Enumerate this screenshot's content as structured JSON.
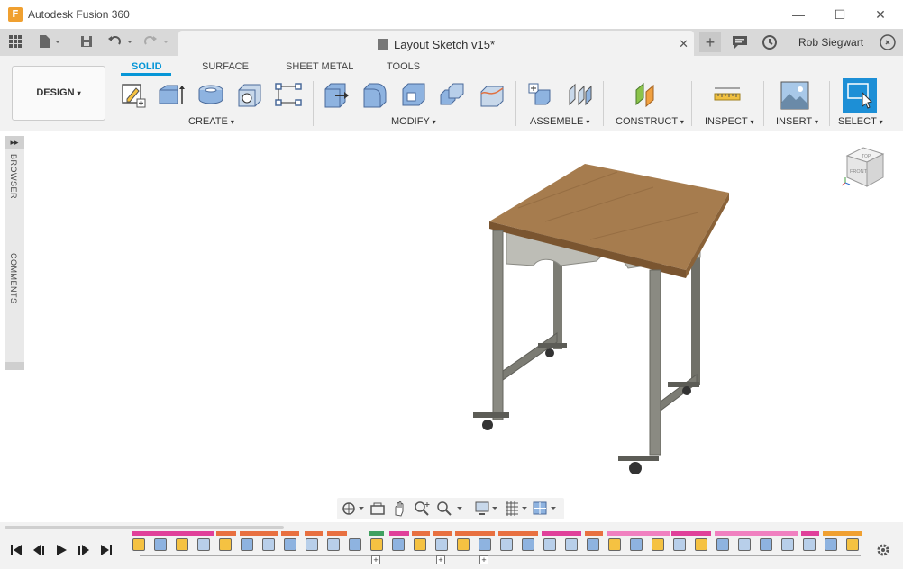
{
  "window": {
    "title": "Autodesk Fusion 360",
    "logo_letter": "F"
  },
  "window_controls": {
    "minimize": "—",
    "maximize": "☐",
    "close": "✕"
  },
  "quick_access": {
    "grid_icon": "grid-icon",
    "file_icon": "file-icon",
    "save_icon": "save-icon",
    "undo_icon": "undo-icon",
    "redo_icon": "redo-icon"
  },
  "document": {
    "tab_title": "Layout Sketch v15*",
    "close": "✕"
  },
  "right_bar": {
    "add": "+",
    "user": "Rob Siegwart"
  },
  "workspace": {
    "label": "DESIGN"
  },
  "ribbon_tabs": [
    {
      "label": "SOLID",
      "active": true
    },
    {
      "label": "SURFACE",
      "active": false
    },
    {
      "label": "SHEET METAL",
      "active": false
    },
    {
      "label": "TOOLS",
      "active": false
    }
  ],
  "groups": {
    "create": "CREATE",
    "modify": "MODIFY",
    "assemble": "ASSEMBLE",
    "construct": "CONSTRUCT",
    "inspect": "INSPECT",
    "insert": "INSERT",
    "select": "SELECT"
  },
  "caret": "▾",
  "side_panel": {
    "browser": "BROWSER",
    "comments": "COMMENTS"
  },
  "viewcube": {
    "top": "TOP",
    "front": "FRONT"
  },
  "colors": {
    "accent": "#0696d7",
    "wood": "#a0784a",
    "metal": "#7c7c74"
  }
}
